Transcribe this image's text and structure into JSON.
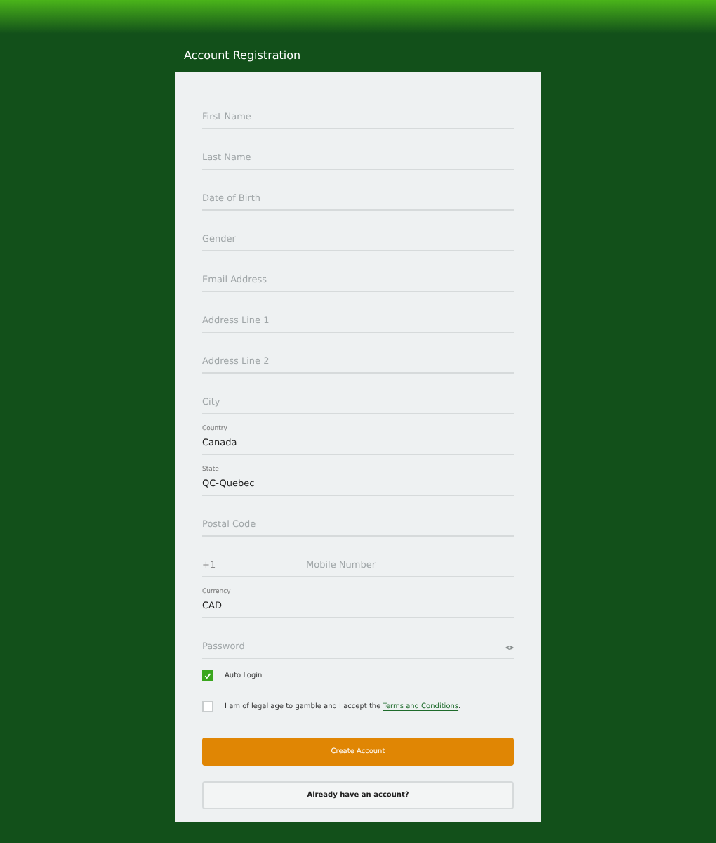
{
  "title": "Account Registration",
  "fields": [
    {
      "kind": "text",
      "placeholder": "First Name"
    },
    {
      "kind": "text",
      "placeholder": "Last Name"
    },
    {
      "kind": "text",
      "placeholder": "Date of Birth"
    },
    {
      "kind": "text",
      "placeholder": "Gender"
    },
    {
      "kind": "text",
      "placeholder": "Email Address"
    },
    {
      "kind": "text",
      "placeholder": "Address Line 1"
    },
    {
      "kind": "text",
      "placeholder": "Address Line 2"
    },
    {
      "kind": "text",
      "placeholder": "City"
    },
    {
      "kind": "select",
      "label": "Country",
      "value": "Canada"
    },
    {
      "kind": "select",
      "label": "State",
      "value": "QC-Quebec"
    },
    {
      "kind": "text",
      "placeholder": "Postal Code"
    },
    {
      "kind": "phone",
      "prefix": "+1",
      "placeholder": "Mobile Number"
    },
    {
      "kind": "select",
      "label": "Currency",
      "value": "CAD"
    },
    {
      "kind": "password",
      "placeholder": "Password"
    }
  ],
  "checkboxes": [
    {
      "text": "Auto Login",
      "checked": true
    },
    {
      "text": "I am of legal age to gamble and I accept the",
      "link": "Terms and Conditions",
      "after": ".",
      "checked": false
    }
  ],
  "buttons": [
    {
      "kind": "primary",
      "label": "Create Account"
    },
    {
      "kind": "secondary",
      "label": "Already have an account?"
    }
  ]
}
